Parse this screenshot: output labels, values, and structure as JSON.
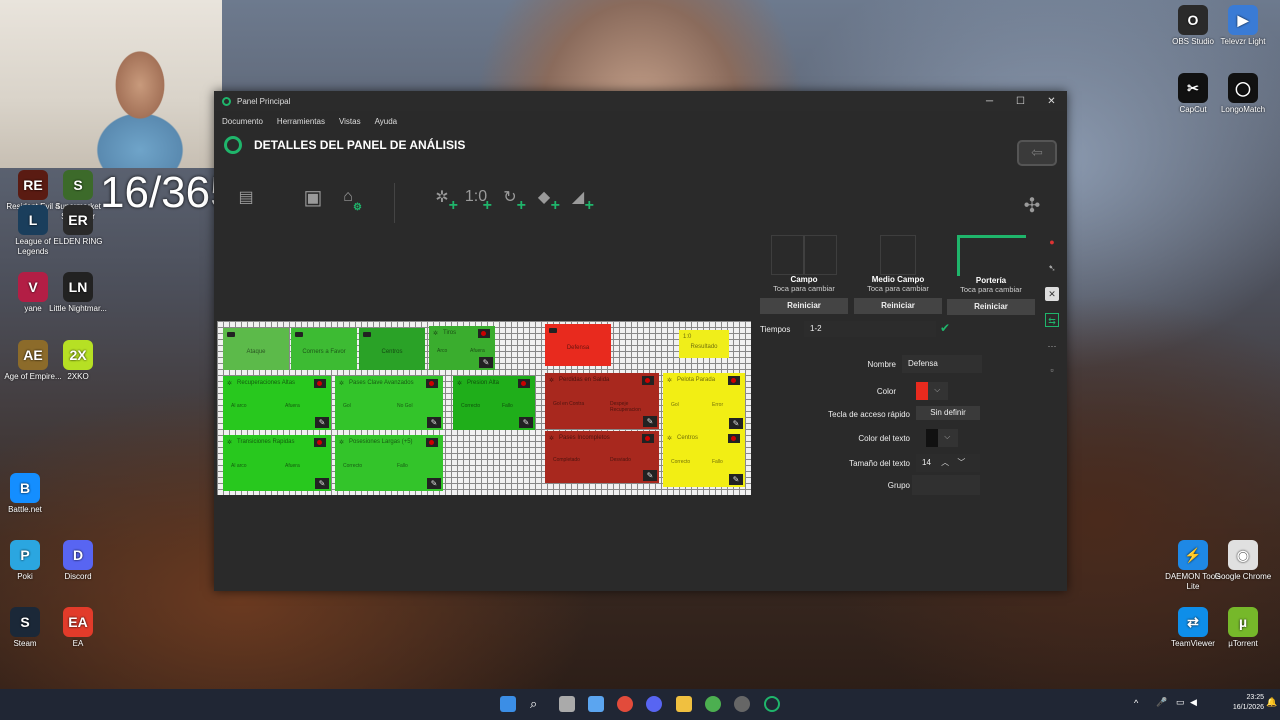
{
  "desktop": {
    "counter": "16/365",
    "left_icons": [
      {
        "label": "Resident Evil 4 (2005)",
        "color": "#5a1b12",
        "glyph": "RE"
      },
      {
        "label": "Supermarket Simulator",
        "color": "#3c6a2a",
        "glyph": "S"
      },
      {
        "label": "League of Legends",
        "color": "#1a3e5c",
        "glyph": "L"
      },
      {
        "label": "ELDEN RING",
        "color": "#2a2a2a",
        "glyph": "ER"
      },
      {
        "label": "yane",
        "color": "#b31e45",
        "glyph": "V"
      },
      {
        "label": "Little Nightmar...",
        "color": "#222222",
        "glyph": "LN"
      },
      {
        "label": "Age of Empire...",
        "color": "#8c6b2a",
        "glyph": "AE"
      },
      {
        "label": "2XKO",
        "color": "#b6e024",
        "glyph": "2X"
      },
      {
        "label": "Battle.net",
        "color": "#148eff",
        "glyph": "B"
      },
      {
        "label": "Poki",
        "color": "#2ba6e0",
        "glyph": "P"
      },
      {
        "label": "Discord",
        "color": "#5865f2",
        "glyph": "D"
      },
      {
        "label": "Steam",
        "color": "#1b2838",
        "glyph": "S"
      },
      {
        "label": "EA",
        "color": "#e23b2a",
        "glyph": "EA"
      }
    ],
    "right_icons": [
      {
        "label": "OBS Studio",
        "color": "#2a2a2a",
        "glyph": "O"
      },
      {
        "label": "Televzr Light",
        "color": "#3a7bd5",
        "glyph": "▶"
      },
      {
        "label": "CapCut",
        "color": "#111111",
        "glyph": "✂"
      },
      {
        "label": "LongoMatch",
        "color": "#111111",
        "glyph": "◯"
      },
      {
        "label": "DAEMON Tools Lite",
        "color": "#1e88e5",
        "glyph": "⚡"
      },
      {
        "label": "Google Chrome",
        "color": "#e0e0e0",
        "glyph": "◉"
      },
      {
        "label": "TeamViewer",
        "color": "#0e8ee9",
        "glyph": "⇄"
      },
      {
        "label": "µTorrent",
        "color": "#76b82a",
        "glyph": "µ"
      }
    ]
  },
  "window": {
    "title": "Panel Principal",
    "menu": [
      "Documento",
      "Herramientas",
      "Vistas",
      "Ayuda"
    ],
    "header_title": "DETALLES DEL PANEL DE ANÁLISIS",
    "back_icon": "back-arrow-icon"
  },
  "canvas": {
    "buttons": [
      {
        "title": "",
        "center": "Ataque",
        "color": "#5cba4a",
        "icon": "tag",
        "edit": false
      },
      {
        "title": "",
        "center": "Corners a Favor",
        "color": "#3dbb33",
        "icon": "tag",
        "edit": false
      },
      {
        "title": "",
        "center": "Centros",
        "color": "#2aa227",
        "icon": "tag",
        "edit": false
      },
      {
        "title": "Tiros",
        "center": "",
        "subs": [
          "Arco",
          "Afuera"
        ],
        "color": "#3aad2e",
        "icon": "cat",
        "edit": true
      },
      {
        "title": "",
        "center": "Defensa",
        "color": "#e82a1e",
        "icon": "tag",
        "edit": false
      },
      {
        "title": "1:0",
        "center": "Resultado",
        "color": "#f0ee1a",
        "icon": "none",
        "edit": false
      },
      {
        "title": "Recuperaciones Altas",
        "subs": [
          "Al arco",
          "Afuera"
        ],
        "color": "#28c81e",
        "icon": "cat",
        "edit": true
      },
      {
        "title": "Pases Clave Avanzados",
        "subs": [
          "Gol",
          "No Gol"
        ],
        "color": "#33c42a",
        "icon": "cat",
        "edit": true
      },
      {
        "title": "Presion Alta",
        "subs": [
          "Correcto",
          "Fallo"
        ],
        "color": "#1fae1a",
        "icon": "cat",
        "edit": true
      },
      {
        "title": "Perdidas en Salida",
        "subs": [
          "Gol en Contra",
          "Despeje Recuperacion"
        ],
        "color": "#a8281e",
        "icon": "cat",
        "edit": true
      },
      {
        "title": "Pelota Parada",
        "subs": [
          "Gol",
          "Error"
        ],
        "color": "#f2ee14",
        "icon": "cat",
        "edit": true
      },
      {
        "title": "Transiciones Rapidas",
        "subs": [
          "Al arco",
          "Afuera"
        ],
        "color": "#28c81e",
        "icon": "cat",
        "edit": true
      },
      {
        "title": "Posesiones Largas (+5)",
        "subs": [
          "Correcto",
          "Fallo"
        ],
        "color": "#33c42a",
        "icon": "cat",
        "edit": true
      },
      {
        "title": "Pases Incompletos",
        "subs": [
          "Completado",
          "Desviado"
        ],
        "color": "#a8281e",
        "icon": "cat",
        "edit": true
      },
      {
        "title": "Centros",
        "subs": [
          "Correcto",
          "Fallo"
        ],
        "color": "#f2ee14",
        "icon": "cat",
        "edit": true
      }
    ]
  },
  "fields": [
    {
      "name": "Campo",
      "hint": "Toca para cambiar",
      "reset": "Reiniciar"
    },
    {
      "name": "Medio Campo",
      "hint": "Toca para cambiar",
      "reset": "Reiniciar"
    },
    {
      "name": "Portería",
      "hint": "Toca para cambiar",
      "reset": "Reiniciar"
    }
  ],
  "props": {
    "tiempos_label": "Tiempos",
    "tiempos_value": "1-2",
    "nombre_label": "Nombre",
    "nombre_value": "Defensa",
    "color_label": "Color",
    "color_value": "#e82a1e",
    "hotkey_label": "Tecla de acceso rápido",
    "hotkey_value": "Sin definir",
    "text_color_label": "Color del texto",
    "text_color_value": "#111111",
    "text_size_label": "Tamaño del texto",
    "text_size_value": "14",
    "group_label": "Grupo",
    "group_value": ""
  },
  "taskbar": {
    "time": "23:25",
    "date": "16/1/2026"
  },
  "colors": {
    "accent": "#1fb56b"
  }
}
